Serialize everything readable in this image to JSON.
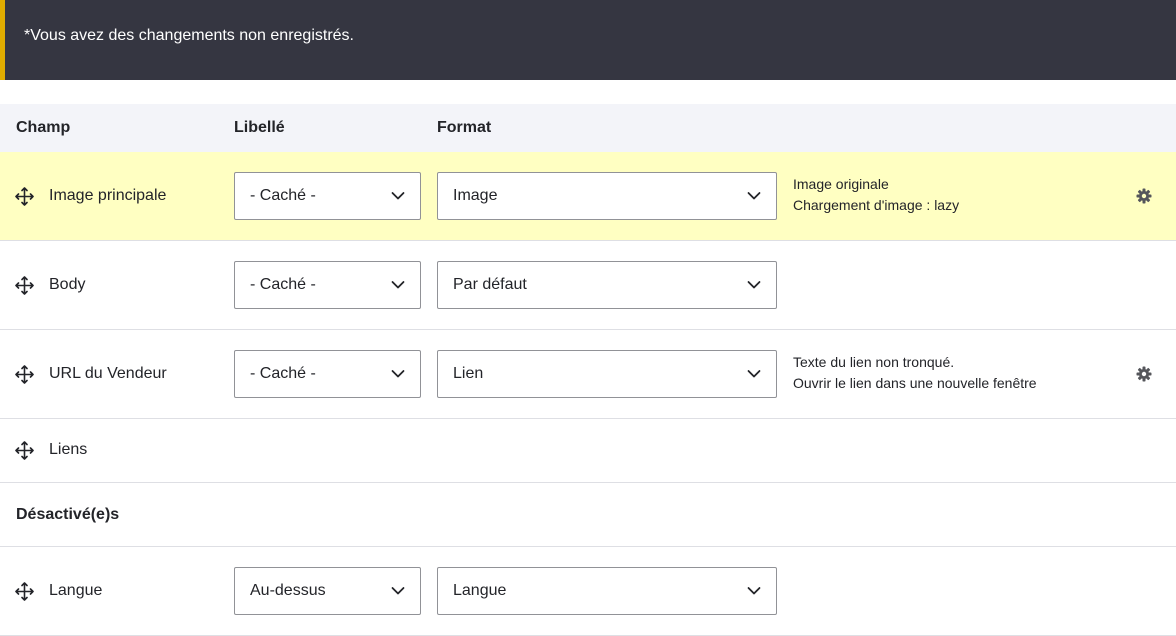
{
  "warning": {
    "message": "*Vous avez des changements non enregistrés."
  },
  "table": {
    "headers": {
      "field": "Champ",
      "label": "Libellé",
      "format": "Format"
    },
    "rows": [
      {
        "name": "Image principale",
        "label": "- Caché -",
        "format": "Image",
        "summary": [
          "Image originale",
          "Chargement d'image : lazy"
        ],
        "has_settings": true,
        "highlighted": true
      },
      {
        "name": "Body",
        "label": "- Caché -",
        "format": "Par défaut",
        "summary": [],
        "has_settings": false,
        "highlighted": false
      },
      {
        "name": "URL du Vendeur",
        "label": "- Caché -",
        "format": "Lien",
        "summary": [
          "Texte du lien non tronqué.",
          "Ouvrir le lien dans une nouvelle fenêtre"
        ],
        "has_settings": true,
        "highlighted": false
      },
      {
        "name": "Liens"
      }
    ],
    "disabled_region": {
      "title": "Désactivé(e)s",
      "rows": [
        {
          "name": "Langue",
          "label": "Au-dessus",
          "format": "Langue"
        }
      ]
    }
  },
  "icons": {
    "drag": "move-arrows-icon",
    "settings": "gear-icon",
    "dropdown": "chevron-down-icon"
  },
  "colors": {
    "warning_bg": "#353641",
    "warning_accent": "#e0ac00",
    "highlight_row": "#ffffc2",
    "header_bg": "#f3f4f9"
  }
}
